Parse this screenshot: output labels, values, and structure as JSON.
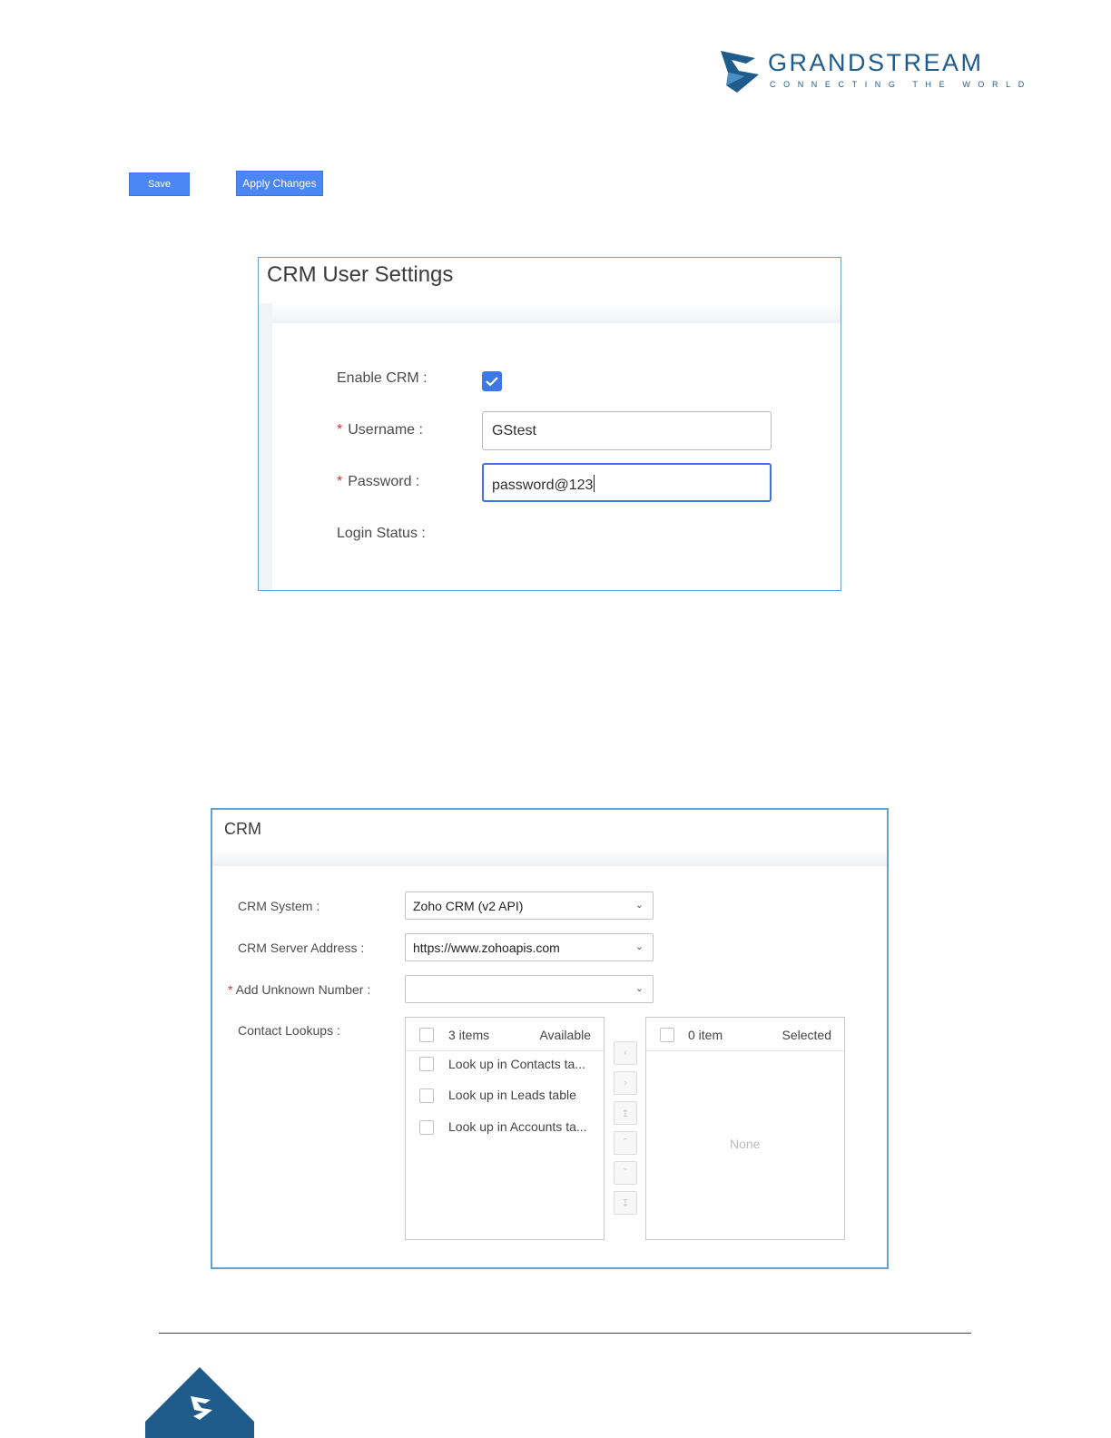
{
  "logo": {
    "brand": "GRANDSTREAM",
    "tagline": "CONNECTING THE WORLD",
    "brand_color": "#1f5c8c"
  },
  "toolbar": {
    "save_label": "Save",
    "apply_label": "Apply Changes",
    "button_color": "#4a86f4"
  },
  "crm_user_settings": {
    "title": "CRM User Settings",
    "enable_label": "Enable CRM :",
    "enable_checked": true,
    "username_label": "Username :",
    "username_value": "GStest",
    "password_label": "Password :",
    "password_value": "password@123",
    "login_status_label": "Login Status :",
    "required_mark": "*"
  },
  "crm": {
    "title": "CRM",
    "system_label": "CRM System :",
    "system_value": "Zoho CRM (v2 API)",
    "server_label": "CRM Server Address :",
    "server_value": "https://www.zohoapis.com",
    "unknown_label": "Add Unknown Number :",
    "unknown_value": "",
    "lookups_label": "Contact Lookups :",
    "required_mark": "*",
    "available": {
      "count": "3 items",
      "title": "Available",
      "items": [
        "Look up in Contacts ta...",
        "Look up in Leads table",
        "Look up in Accounts ta..."
      ]
    },
    "selected": {
      "count": "0 item",
      "title": "Selected",
      "empty_text": "None"
    },
    "transfer_icons": [
      "chevron-left-icon",
      "chevron-right-icon",
      "move-top-icon",
      "move-up-icon",
      "move-down-icon",
      "move-bottom-icon"
    ]
  }
}
